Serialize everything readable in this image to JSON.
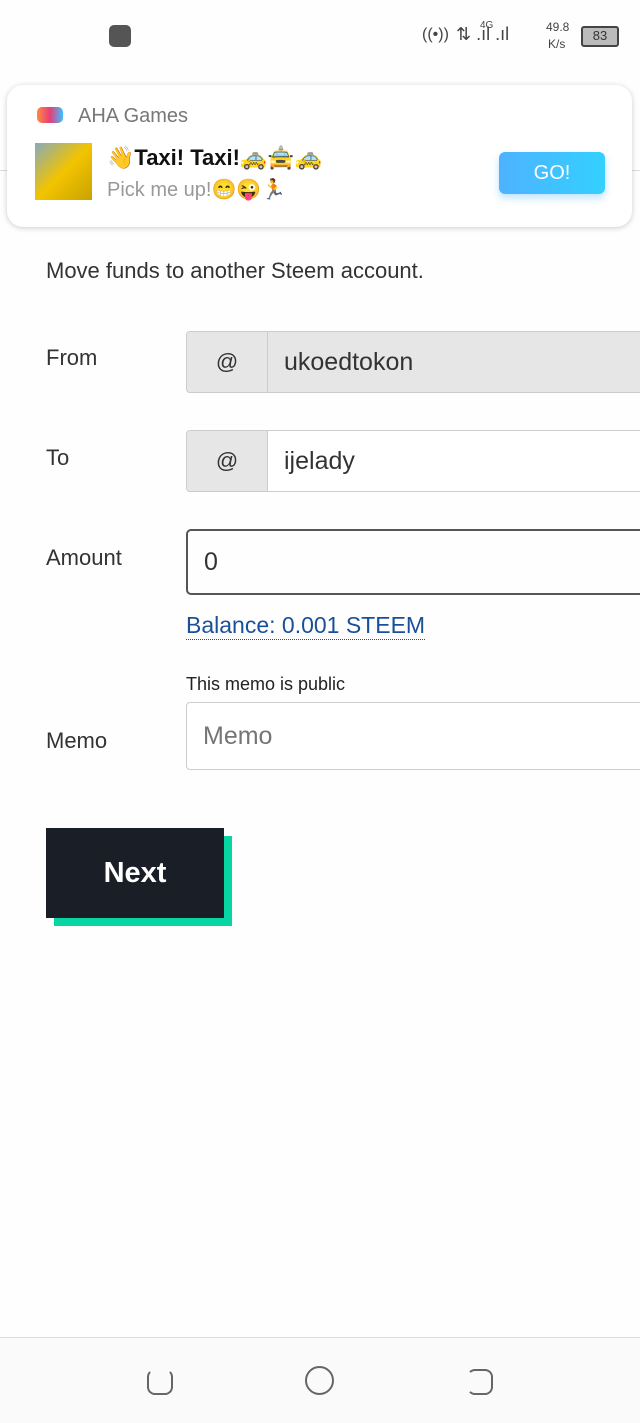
{
  "status": {
    "network": "4G",
    "speed_value": "49.8",
    "speed_unit": "K/s",
    "battery": "83"
  },
  "notification": {
    "app": "AHA Games",
    "title": "👋Taxi! Taxi!🚕🚖🚕",
    "body": "Pick me up!😁😜🏃",
    "button": "GO!"
  },
  "form": {
    "description": "Move funds to another Steem account.",
    "from_label": "From",
    "from_value": "ukoedtokon",
    "to_label": "To",
    "to_value": "ijelady",
    "at": "@",
    "amount_label": "Amount",
    "amount_value": "0",
    "balance": "Balance: 0.001 STEEM",
    "memo_note": "This memo is public",
    "memo_label": "Memo",
    "memo_placeholder": "Memo",
    "next": "Next"
  },
  "colors": {
    "accent": "#07d6a2",
    "button_bg": "#1a1f27",
    "link": "#1a5099",
    "go": "#3cb0ff"
  }
}
